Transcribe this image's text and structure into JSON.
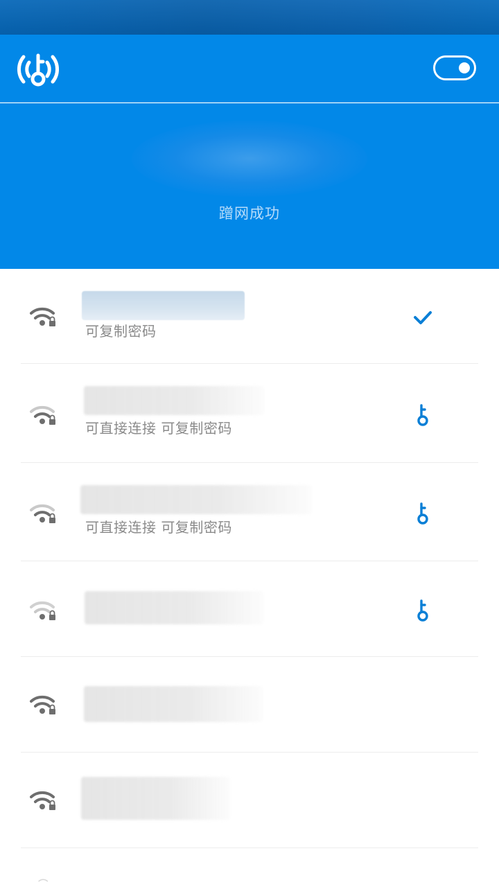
{
  "header": {
    "logo_icon": "wifi-key-logo-icon",
    "toggle_icon": "toggle-switch-on-icon"
  },
  "hero": {
    "status_text": "蹭网成功"
  },
  "colors": {
    "primary": "#0288e8",
    "accent_icon": "#0a7fd6",
    "subtext": "#8a8a8a"
  },
  "networks": [
    {
      "subtitle": "可复制密码",
      "signal_icon": "wifi-locked-icon",
      "action_icon": "checkmark-icon"
    },
    {
      "subtitle": "可直接连接 可复制密码",
      "signal_icon": "wifi-locked-icon",
      "action_icon": "key-icon"
    },
    {
      "subtitle": "可直接连接 可复制密码",
      "signal_icon": "wifi-locked-icon",
      "action_icon": "key-icon"
    },
    {
      "subtitle": "",
      "signal_icon": "wifi-locked-icon",
      "action_icon": "key-icon"
    },
    {
      "subtitle": "",
      "signal_icon": "wifi-locked-icon",
      "action_icon": ""
    },
    {
      "subtitle": "",
      "signal_icon": "wifi-locked-icon",
      "action_icon": ""
    }
  ]
}
